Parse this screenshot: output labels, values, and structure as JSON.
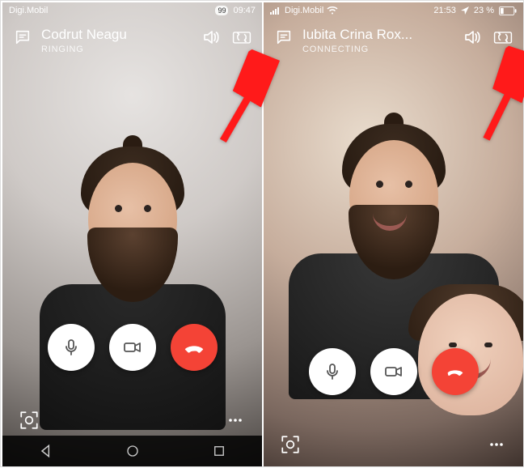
{
  "screens": {
    "left": {
      "carrier": "Digi.Mobil",
      "battery_badge": "99",
      "time": "09:47",
      "contact_name": "Codrut Neagu",
      "call_status": "RINGING"
    },
    "right": {
      "carrier": "Digi.Mobil",
      "time": "21:53",
      "battery_text": "23 %",
      "contact_name": "Iubita Crina Rox...",
      "call_status": "CONNECTING"
    }
  },
  "icons": {
    "chat": "chat-icon",
    "speaker": "speaker-icon",
    "switch_camera": "switch-camera-icon",
    "mic": "mic-icon",
    "video": "video-icon",
    "hangup": "hangup-icon",
    "reaction": "reaction-icon",
    "more": "more-icon"
  }
}
